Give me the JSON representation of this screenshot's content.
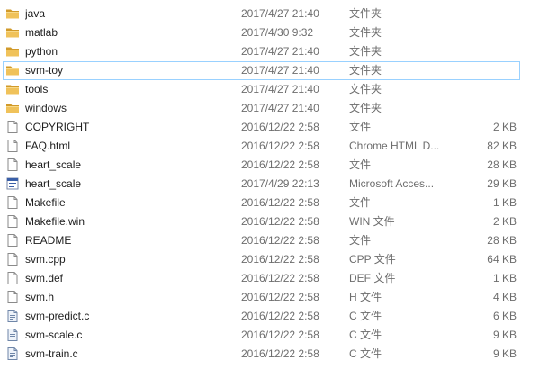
{
  "files": [
    {
      "name": "java",
      "date": "2017/4/27 21:40",
      "type": "文件夹",
      "size": "",
      "icon": "folder-icon"
    },
    {
      "name": "matlab",
      "date": "2017/4/30 9:32",
      "type": "文件夹",
      "size": "",
      "icon": "folder-icon"
    },
    {
      "name": "python",
      "date": "2017/4/27 21:40",
      "type": "文件夹",
      "size": "",
      "icon": "folder-icon"
    },
    {
      "name": "svm-toy",
      "date": "2017/4/27 21:40",
      "type": "文件夹",
      "size": "",
      "icon": "folder-icon",
      "selected": true
    },
    {
      "name": "tools",
      "date": "2017/4/27 21:40",
      "type": "文件夹",
      "size": "",
      "icon": "folder-icon"
    },
    {
      "name": "windows",
      "date": "2017/4/27 21:40",
      "type": "文件夹",
      "size": "",
      "icon": "folder-icon"
    },
    {
      "name": "COPYRIGHT",
      "date": "2016/12/22 2:58",
      "type": "文件",
      "size": "2 KB",
      "icon": "file-icon"
    },
    {
      "name": "FAQ.html",
      "date": "2016/12/22 2:58",
      "type": "Chrome HTML D...",
      "size": "82 KB",
      "icon": "file-icon"
    },
    {
      "name": "heart_scale",
      "date": "2016/12/22 2:58",
      "type": "文件",
      "size": "28 KB",
      "icon": "file-icon"
    },
    {
      "name": "heart_scale",
      "date": "2017/4/29 22:13",
      "type": "Microsoft Acces...",
      "size": "29 KB",
      "icon": "access-file-icon"
    },
    {
      "name": "Makefile",
      "date": "2016/12/22 2:58",
      "type": "文件",
      "size": "1 KB",
      "icon": "file-icon"
    },
    {
      "name": "Makefile.win",
      "date": "2016/12/22 2:58",
      "type": "WIN 文件",
      "size": "2 KB",
      "icon": "file-icon"
    },
    {
      "name": "README",
      "date": "2016/12/22 2:58",
      "type": "文件",
      "size": "28 KB",
      "icon": "file-icon"
    },
    {
      "name": "svm.cpp",
      "date": "2016/12/22 2:58",
      "type": "CPP 文件",
      "size": "64 KB",
      "icon": "file-icon"
    },
    {
      "name": "svm.def",
      "date": "2016/12/22 2:58",
      "type": "DEF 文件",
      "size": "1 KB",
      "icon": "file-icon"
    },
    {
      "name": "svm.h",
      "date": "2016/12/22 2:58",
      "type": "H 文件",
      "size": "4 KB",
      "icon": "file-icon"
    },
    {
      "name": "svm-predict.c",
      "date": "2016/12/22 2:58",
      "type": "C 文件",
      "size": "6 KB",
      "icon": "c-source-file-icon"
    },
    {
      "name": "svm-scale.c",
      "date": "2016/12/22 2:58",
      "type": "C 文件",
      "size": "9 KB",
      "icon": "c-source-file-icon"
    },
    {
      "name": "svm-train.c",
      "date": "2016/12/22 2:58",
      "type": "C 文件",
      "size": "9 KB",
      "icon": "c-source-file-icon"
    }
  ],
  "colors": {
    "folder": "#e8b64a",
    "folder_dark": "#d19a2a",
    "selection_border": "#99d1ff",
    "secondary_text": "#6d6d6d"
  }
}
